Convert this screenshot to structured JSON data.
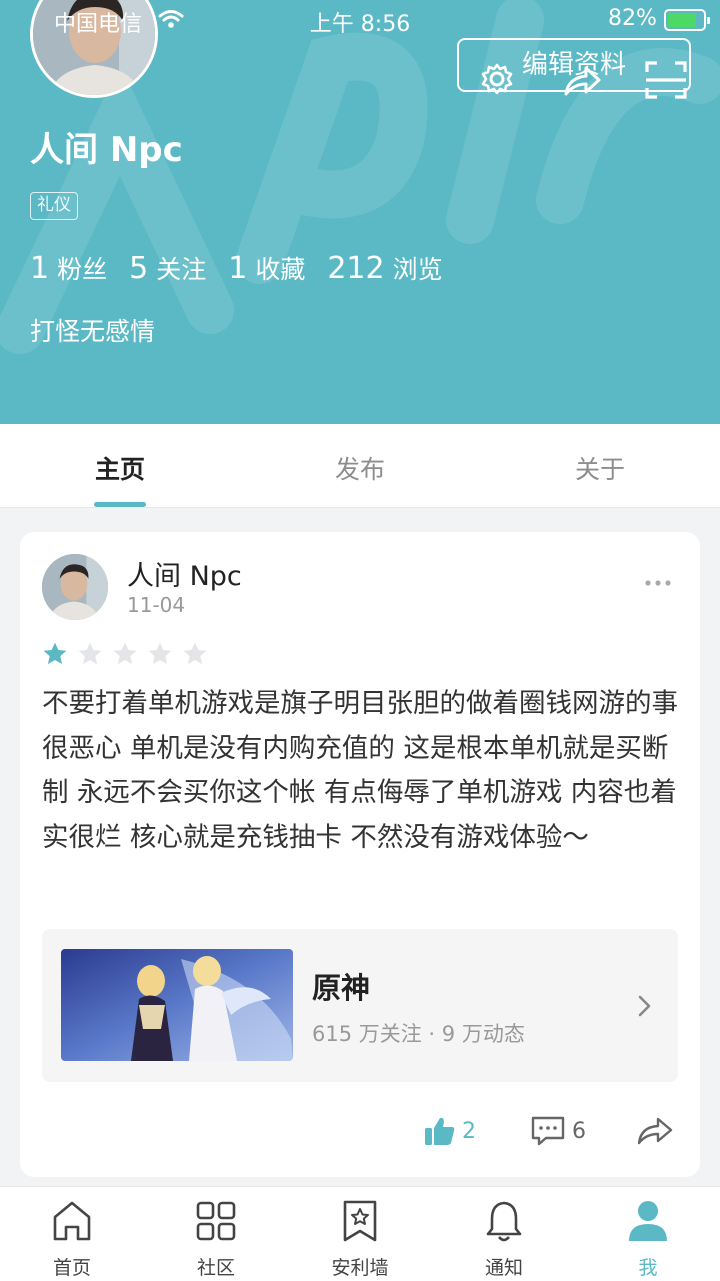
{
  "status_bar": {
    "carrier": "中国电信",
    "time": "上午 8:56",
    "battery": "82%",
    "battery_level": 0.82
  },
  "profile": {
    "edit_label": "编辑资料",
    "username": "人间 Npc",
    "tag": "礼仪",
    "stats": [
      {
        "value": "1",
        "label": "粉丝"
      },
      {
        "value": "5",
        "label": "关注"
      },
      {
        "value": "1",
        "label": "收藏"
      },
      {
        "value": "212",
        "label": "浏览"
      }
    ],
    "bio": "打怪无感情",
    "accent_color": "#5bb9c6"
  },
  "tabs": [
    {
      "label": "主页",
      "active": true
    },
    {
      "label": "发布",
      "active": false
    },
    {
      "label": "关于",
      "active": false
    }
  ],
  "post": {
    "author": "人间 Npc",
    "date": "11-04",
    "rating": 1,
    "rating_max": 5,
    "content": "不要打着单机游戏是旗子明目张胆的做着圈钱网游的事 很恶心 单机是没有内购充值的 这是根本单机就是买断制 永远不会买你这个帐 有点侮辱了单机游戏 内容也着实很烂 核心就是充钱抽卡 不然没有游戏体验～",
    "game": {
      "name": "原神",
      "meta": "615 万关注 · 9 万动态"
    },
    "likes": "2",
    "comments": "6"
  },
  "bottom_nav": [
    {
      "label": "首页",
      "icon": "home-icon"
    },
    {
      "label": "社区",
      "icon": "grid-icon"
    },
    {
      "label": "安利墙",
      "icon": "bookmark-star-icon"
    },
    {
      "label": "通知",
      "icon": "bell-icon"
    },
    {
      "label": "我",
      "icon": "person-icon",
      "active": true
    }
  ]
}
